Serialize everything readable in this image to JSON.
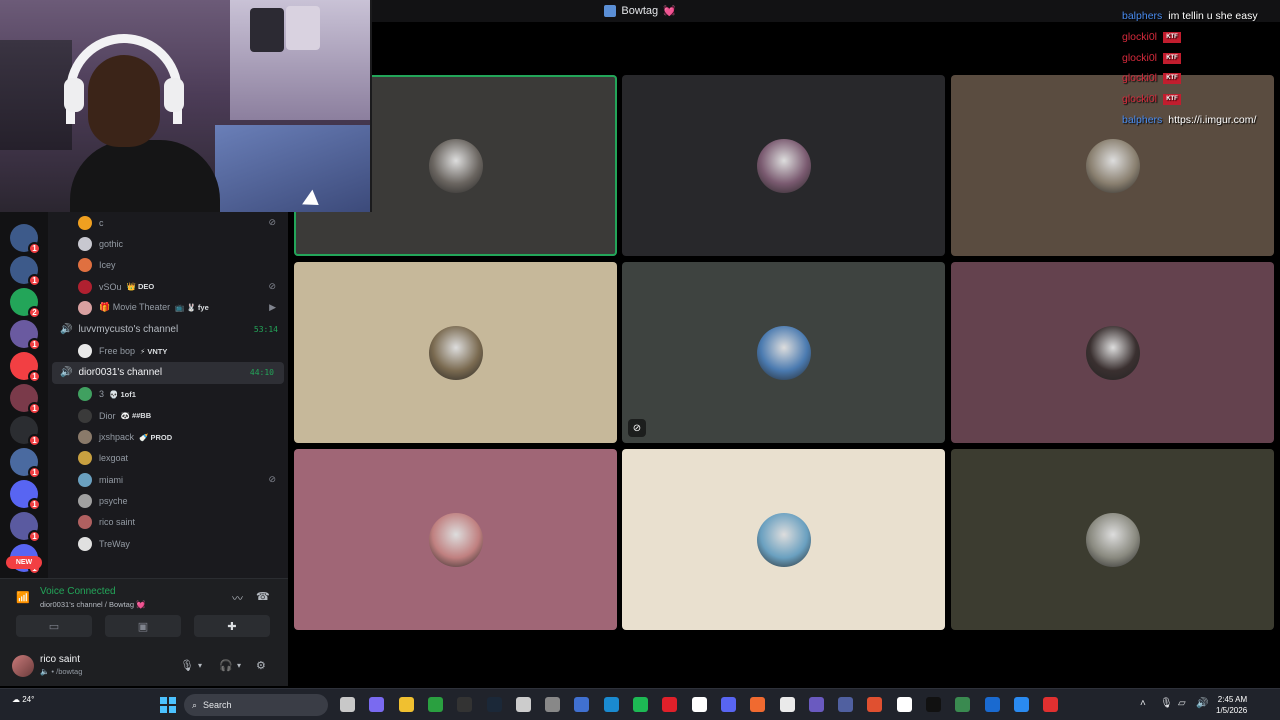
{
  "window": {
    "title": "Bowtag",
    "title_emoji": "💓"
  },
  "server_rail": {
    "servers": [
      {
        "icon": "hooded-server-icon",
        "badge": "1",
        "color": "#3d5a8a"
      },
      {
        "icon": "hooded-server-icon",
        "badge": "1",
        "color": "#3d5a8a"
      },
      {
        "icon": "discord-icon",
        "badge": "2",
        "color": "#23a559"
      },
      {
        "icon": "anime-server-icon",
        "badge": "1",
        "color": "#6a5aa0"
      },
      {
        "icon": "discord-icon",
        "badge": "1",
        "color": "#f23f43"
      },
      {
        "icon": "photo-server-icon",
        "badge": "1",
        "color": "#7a3a4a"
      },
      {
        "icon": "add-server-icon",
        "badge": "1",
        "color": "#2b2d31"
      },
      {
        "icon": "photo-server-icon",
        "badge": "1",
        "color": "#4a6aa0"
      },
      {
        "icon": "discord-icon",
        "badge": "1",
        "color": "#5865f2"
      },
      {
        "icon": "photo-server-icon",
        "badge": "1",
        "color": "#5a5aa0"
      },
      {
        "icon": "discord-icon",
        "badge": "1",
        "color": "#5865f2"
      }
    ],
    "new_label": "NEW"
  },
  "channels": {
    "group1_members": [
      {
        "name": "c",
        "tag": "",
        "avatar_color": "#f0a020",
        "status_icon": "muted-icon"
      },
      {
        "name": "gothic",
        "tag": "",
        "avatar_color": "#c8c8d0",
        "status_icon": ""
      },
      {
        "name": "Icey",
        "tag": "",
        "avatar_color": "#e07040",
        "status_icon": ""
      },
      {
        "name": "vSOu",
        "tag": "👑 DEO",
        "avatar_color": "#b02030",
        "status_icon": "muted-deafened-icon"
      },
      {
        "name": "🎁 Movie Theater",
        "tag": "📺 🐰 fye",
        "avatar_color": "#d8a0a0",
        "status_icon": "video-icon"
      }
    ],
    "channel1": {
      "name": "luvvmycusto's channel",
      "timer": "53:14"
    },
    "channel1_members": [
      {
        "name": "Free bop",
        "tag": "⚡ VNTY",
        "avatar_color": "#e8e8e8",
        "status_icon": ""
      }
    ],
    "channel2": {
      "name": "dior0031's channel",
      "timer": "44:10"
    },
    "channel2_members": [
      {
        "name": "3",
        "tag": "💀 1of1",
        "avatar_color": "#40a060",
        "status_icon": ""
      },
      {
        "name": "Dior",
        "tag": "🐼 ##BB",
        "avatar_color": "#3a3a3a",
        "status_icon": ""
      },
      {
        "name": "jxshpack",
        "tag": "🍼 PROD",
        "avatar_color": "#8a7a6a",
        "status_icon": ""
      },
      {
        "name": "lexgoat",
        "tag": "",
        "avatar_color": "#c8a040",
        "status_icon": ""
      },
      {
        "name": "miami",
        "tag": "",
        "avatar_color": "#6aa0c0",
        "status_icon": "muted-icon"
      },
      {
        "name": "psyche",
        "tag": "",
        "avatar_color": "#a0a0a0",
        "status_icon": ""
      },
      {
        "name": "rico saint",
        "tag": "",
        "avatar_color": "#b06060",
        "status_icon": ""
      },
      {
        "name": "TreWay",
        "tag": "",
        "avatar_color": "#e0e0e0",
        "status_icon": ""
      }
    ]
  },
  "voice_panel": {
    "status": "Voice Connected",
    "location": "dior0031's channel / Bowtag 💓",
    "user_name": "rico saint",
    "user_status": "🔈 • /bowtag"
  },
  "video_tiles": [
    {
      "bg": "#3b3a38",
      "pfp": "#6a6560",
      "speaking": true,
      "muted": false
    },
    {
      "bg": "#28282b",
      "pfp": "#7a5a70",
      "speaking": false,
      "muted": false
    },
    {
      "bg": "#5a4c40",
      "pfp": "#8a8070",
      "speaking": false,
      "muted": false
    },
    {
      "bg": "#c6b89a",
      "pfp": "#7a6a50",
      "speaking": false,
      "muted": false
    },
    {
      "bg": "#3e4340",
      "pfp": "#4a7ab0",
      "speaking": false,
      "muted": true
    },
    {
      "bg": "#64424e",
      "pfp": "#3a3030",
      "speaking": false,
      "muted": false
    },
    {
      "bg": "#a06676",
      "pfp": "#c08080",
      "speaking": false,
      "muted": false
    },
    {
      "bg": "#e9e0cf",
      "pfp": "#6aa0c0",
      "speaking": false,
      "muted": false
    },
    {
      "bg": "#3c3c30",
      "pfp": "#8a8a80",
      "speaking": false,
      "muted": false
    }
  ],
  "chat_overlay": [
    {
      "user": "balphers",
      "user_color": "blue",
      "message": "im tellin u she easy",
      "emote": ""
    },
    {
      "user": "glocki0l",
      "user_color": "red",
      "message": "",
      "emote": "KTF"
    },
    {
      "user": "glocki0l",
      "user_color": "red",
      "message": "",
      "emote": "KTF"
    },
    {
      "user": "glocki0l",
      "user_color": "red",
      "message": "",
      "emote": "KTF"
    },
    {
      "user": "glocki0l",
      "user_color": "red",
      "message": "",
      "emote": "KTF"
    },
    {
      "user": "balphers",
      "user_color": "blue",
      "message": "https://i.imgur.com/",
      "emote": ""
    }
  ],
  "taskbar": {
    "weather": "24°",
    "search_placeholder": "Search",
    "time": "2:45 AM",
    "date": "1/5/2026",
    "apps": [
      "file-explorer-icon",
      "copilot-icon",
      "folder-icon",
      "xbox-icon",
      "epic-games-icon",
      "steam-icon",
      "chatgpt-icon",
      "settings-icon",
      "vscode-icon",
      "edge-icon",
      "spotify-icon",
      "opera-icon",
      "capcut-icon",
      "discord-icon",
      "messenger-icon",
      "chrome-icon",
      "notes-icon",
      "vpn-icon",
      "fl-studio-icon",
      "capcut-pro-icon",
      "tiktok-icon",
      "game-icon",
      "app-icon",
      "edge-dev-icon",
      "roblox-icon"
    ]
  }
}
